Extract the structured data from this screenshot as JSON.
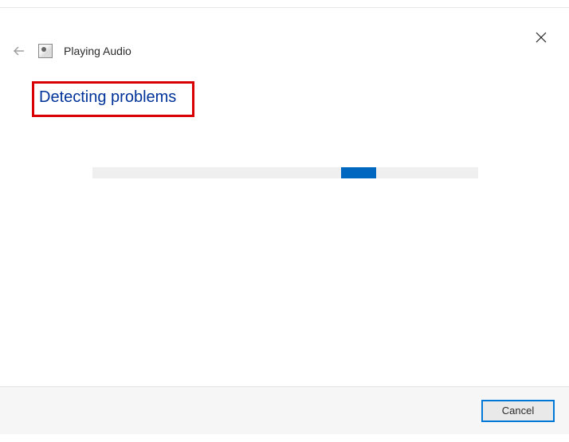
{
  "header": {
    "title": "Playing Audio"
  },
  "main": {
    "status": "Detecting problems"
  },
  "footer": {
    "cancel_label": "Cancel"
  }
}
